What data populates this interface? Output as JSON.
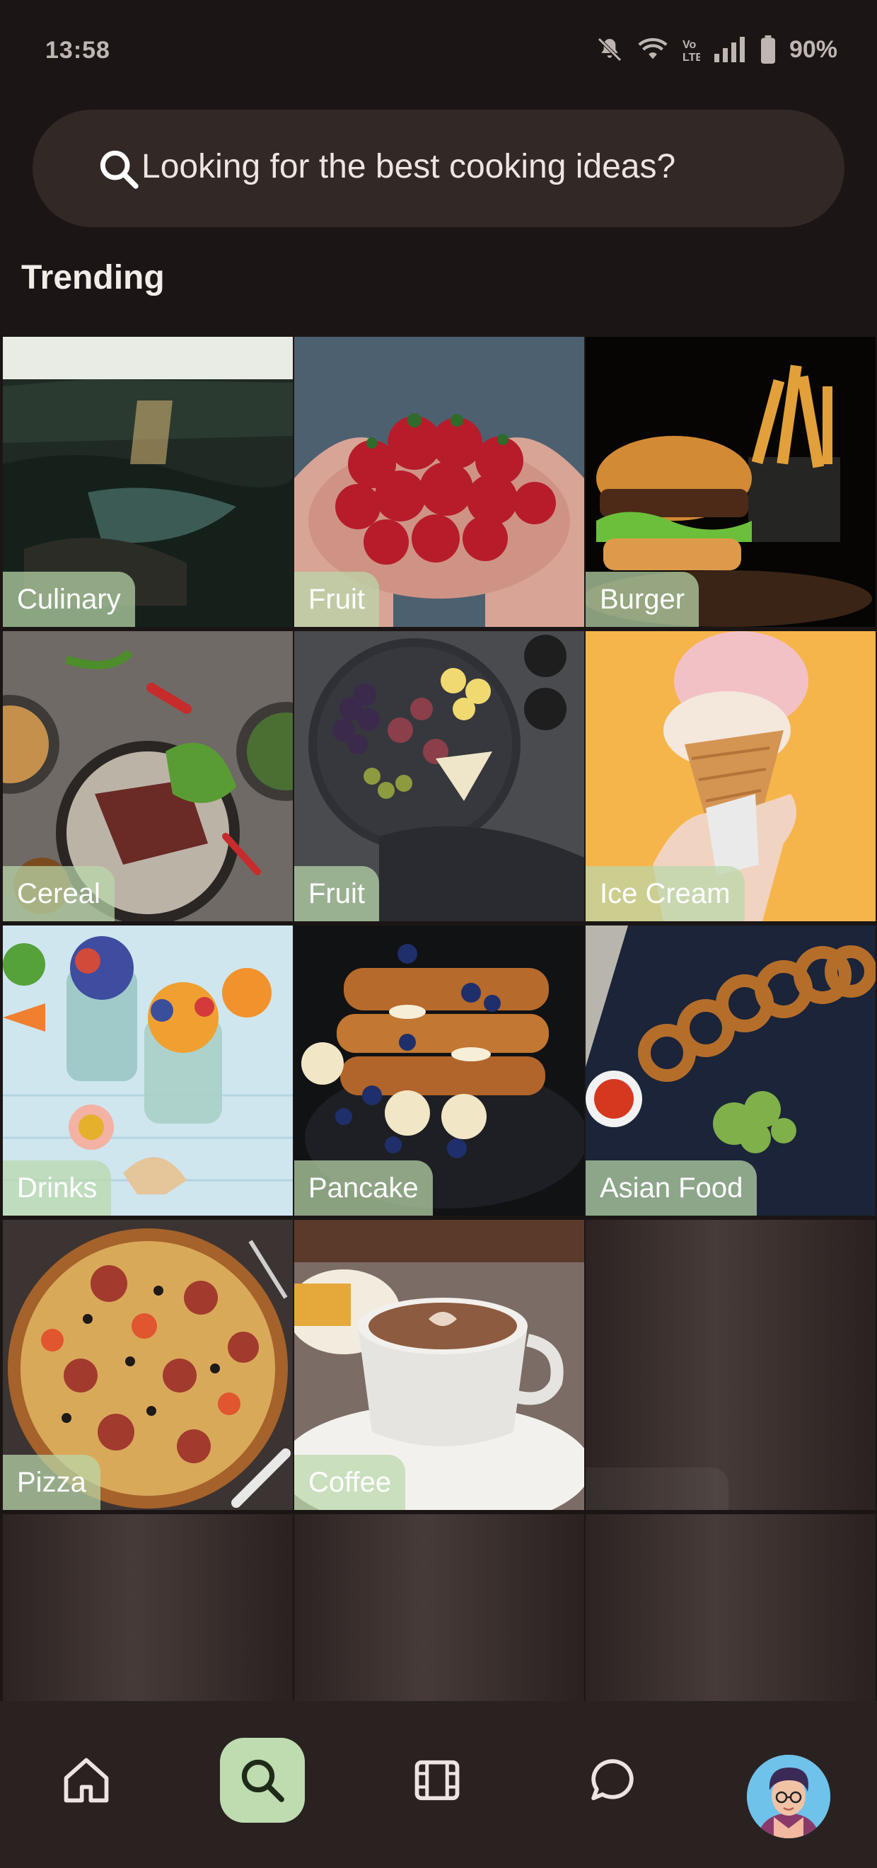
{
  "status_bar": {
    "time": "13:58",
    "battery": "90%",
    "icons": [
      "mute-icon",
      "wifi-icon",
      "volte-icon",
      "signal-icon",
      "battery-icon"
    ]
  },
  "search": {
    "placeholder": "Looking for the best cooking ideas?"
  },
  "section": {
    "title": "Trending"
  },
  "categories": [
    {
      "label": "Culinary"
    },
    {
      "label": "Fruit"
    },
    {
      "label": "Burger"
    },
    {
      "label": "Cereal"
    },
    {
      "label": "Fruit"
    },
    {
      "label": "Ice Cream"
    },
    {
      "label": "Drinks"
    },
    {
      "label": "Pancake"
    },
    {
      "label": "Asian Food"
    },
    {
      "label": "Pizza"
    },
    {
      "label": "Coffee"
    }
  ],
  "bottom_nav": {
    "items": [
      "home-icon",
      "search-icon",
      "video-icon",
      "chat-icon",
      "profile-avatar"
    ],
    "active": "search-icon"
  },
  "colors": {
    "background": "#1b1615",
    "search_bg": "#322826",
    "label_bg": "#bad8aa",
    "active_nav": "#bfdcb0",
    "nav_bg": "#2a2221"
  }
}
